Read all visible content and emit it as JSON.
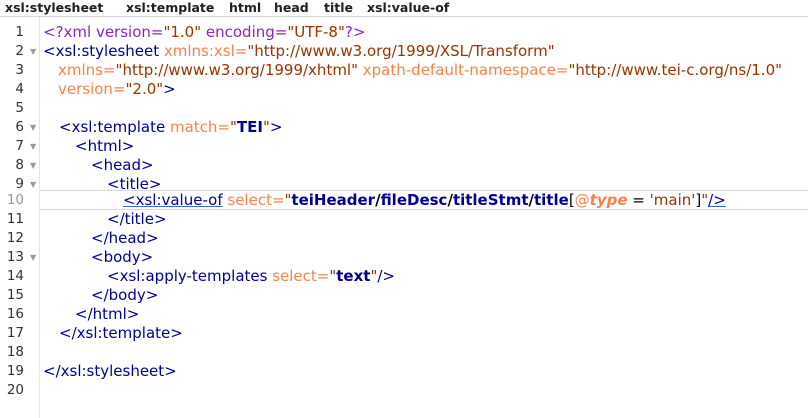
{
  "breadcrumb": {
    "items": [
      {
        "label": "xsl:stylesheet"
      },
      {
        "label": "xsl:template"
      },
      {
        "label": "html"
      },
      {
        "label": "head"
      },
      {
        "label": "title"
      },
      {
        "label": "xsl:value-of"
      }
    ]
  },
  "editor": {
    "line_numbers": [
      "1",
      "2",
      "3",
      "4",
      "5",
      "6",
      "7",
      "8",
      "9",
      "10",
      "11",
      "12",
      "13",
      "14",
      "15",
      "16",
      "17",
      "18",
      "19",
      "20"
    ],
    "current_line": "10",
    "lines": {
      "l1": {
        "open": "<?xml version=",
        "v1": "\"1.0\"",
        "mid": " encoding=",
        "v2": "\"UTF-8\"",
        "close": "?>"
      },
      "l2": {
        "tag": "<xsl:stylesheet",
        "attr": " xmlns:xsl=",
        "val": "\"http://www.w3.org/1999/XSL/Transform\""
      },
      "l3": {
        "attr1": "xmlns=",
        "val1": "\"http://www.w3.org/1999/xhtml\"",
        "attr2": " xpath-default-namespace=",
        "val2": "\"http://www.tei-c.org/ns/1.0\""
      },
      "l4": {
        "attr": "version=",
        "val": "\"2.0\"",
        "close": ">"
      },
      "l6": {
        "tag": "<xsl:template",
        "attr": " match=",
        "q1": "\"",
        "val": "TEI",
        "q2": "\"",
        "close": ">"
      },
      "l7": {
        "text": "<html>"
      },
      "l8": {
        "text": "<head>"
      },
      "l9": {
        "text": "<title>"
      },
      "l10": {
        "tag": "<xsl:value-of",
        "attr": " select=",
        "q1": "\"",
        "p1": "teiHeader",
        "s1": "/",
        "p2": "fileDesc",
        "s2": "/",
        "p3": "titleStmt",
        "s3": "/",
        "p4": "title",
        "br1": "[",
        "at": "@",
        "type": "type",
        "eq": " = ",
        "str": "'main'",
        "br2": "]",
        "q2": "\"",
        "close": "/>"
      },
      "l11": {
        "text": "</title>"
      },
      "l12": {
        "text": "</head>"
      },
      "l13": {
        "text": "<body>"
      },
      "l14": {
        "tag": "<xsl:apply-templates",
        "attr": " select=",
        "q1": "\"",
        "val": "text",
        "q2": "\"",
        "close": "/>"
      },
      "l15": {
        "text": "</body>"
      },
      "l16": {
        "text": "</html>"
      },
      "l17": {
        "text": "</xsl:template>"
      },
      "l19": {
        "text": "</xsl:stylesheet>"
      }
    }
  }
}
